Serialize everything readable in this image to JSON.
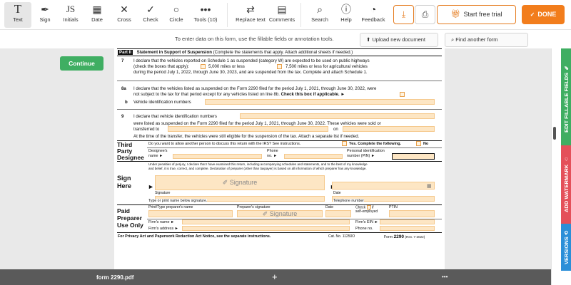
{
  "toolbar": {
    "text": "Text",
    "sign": "Sign",
    "initials": "Initials",
    "initials_glyph": "JS",
    "date": "Date",
    "cross": "Cross",
    "check": "Check",
    "circle": "Circle",
    "tools": "Tools (10)",
    "replace": "Replace text",
    "comments": "Comments",
    "search": "Search",
    "help": "Help",
    "feedback": "Feedback",
    "trial": "Start free trial",
    "done": "DONE"
  },
  "infobar": {
    "message": "To enter data on this form, use the fillable fields or annotation tools.",
    "upload": "Upload new document",
    "find": "Find another form"
  },
  "continue_label": "Continue",
  "form": {
    "part": "Part II",
    "part_title": "Statement in Support of Suspension",
    "part_note": "(Complete the statements that apply. Attach additional sheets if needed.)",
    "l7_num": "7",
    "l7_a": "I declare that the vehicles reported on Schedule 1 as suspended (category W) are expected to be used on public highways",
    "l7_b": "(check the boxes that apply):",
    "l7_opt1": "5,000 miles or less",
    "l7_opt2": "7,500 miles or less for agricultural vehicles",
    "l7_c": "during the period July 1, 2022, through June 30, 2023, and are suspended from the tax. Complete and attach Schedule 1.",
    "l8a_num": "8a",
    "l8a_a": "I declare that the vehicles listed as suspended on the Form 2290 filed for the period July 1, 2021, through June 30, 2022, were",
    "l8a_b": "not subject to the tax for that period except for any vehicles listed on line 8b.",
    "l8a_bold": "Check this box if applicable.",
    "l8b_num": "b",
    "l8b": "Vehicle identification numbers",
    "l9_num": "9",
    "l9_a": "I declare that vehicle identification numbers",
    "l9_b": "were listed as suspended on the Form 2290 filed for the period July 1, 2021, through June 30, 2022. These vehicles were sold or",
    "l9_c": "transferred to",
    "l9_on": "on",
    "l9_d": "At the time of the transfer, the vehicles were still eligible for the suspension of the tax. Attach a separate list if needed.",
    "third_party": [
      "Third",
      "Party",
      "Designee"
    ],
    "tp_q": "Do you want to allow another person to discuss this return with the IRS? See instructions.",
    "tp_yes": "Yes. Complete the following.",
    "tp_no": "No",
    "tp_name": [
      "Designee's",
      "name"
    ],
    "tp_phone": [
      "Phone",
      "no."
    ],
    "tp_pin": [
      "Personal identification",
      "number (PIN)"
    ],
    "sign_here": [
      "Sign",
      "Here"
    ],
    "perjury": [
      "Under penalties of perjury, I declare that I have examined this return, including accompanying schedules and statements, and to the best of my knowledge",
      "and belief, it is true, correct, and complete. Declaration of preparer (other than taxpayer) is based on all information of which preparer has any knowledge."
    ],
    "signature": "Signature",
    "sig_label": "Signature",
    "date_label": "Date",
    "type_name": "Type or print name below signature.",
    "telephone": "Telephone number",
    "paid": [
      "Paid",
      "Preparer",
      "Use Only"
    ],
    "prep_name": "Print/Type preparer's name",
    "prep_sig": "Preparer's signature",
    "prep_date": "Date",
    "check_if": [
      "Check",
      "if",
      "self-employed"
    ],
    "ptin": "PTIN",
    "firm_name": "Firm's name",
    "firm_ein": "Firm's EIN",
    "firm_addr": "Firm's address",
    "phone_no": "Phone no.",
    "footer": "For Privacy Act and Paperwork Reduction Act Notice, see the separate instructions.",
    "cat": "Cat. No. 11250O",
    "form_lbl": "Form",
    "form_num": "2290",
    "rev": "(Rev. 7-2022)"
  },
  "bottom": {
    "filename": "form 2290.pdf",
    "plus": "+",
    "dots": "•••"
  },
  "rail": {
    "edit": "EDIT FILLABLE FIELDS",
    "watermark": "ADD WATERMARK",
    "versions": "VERSIONS"
  },
  "colors": {
    "accent": "#f27d1c",
    "continue": "#3fae62",
    "edit_tab": "#3fae62",
    "watermark_tab": "#e4505a",
    "versions_tab": "#2b8fd8",
    "field": "#fde6c4"
  }
}
